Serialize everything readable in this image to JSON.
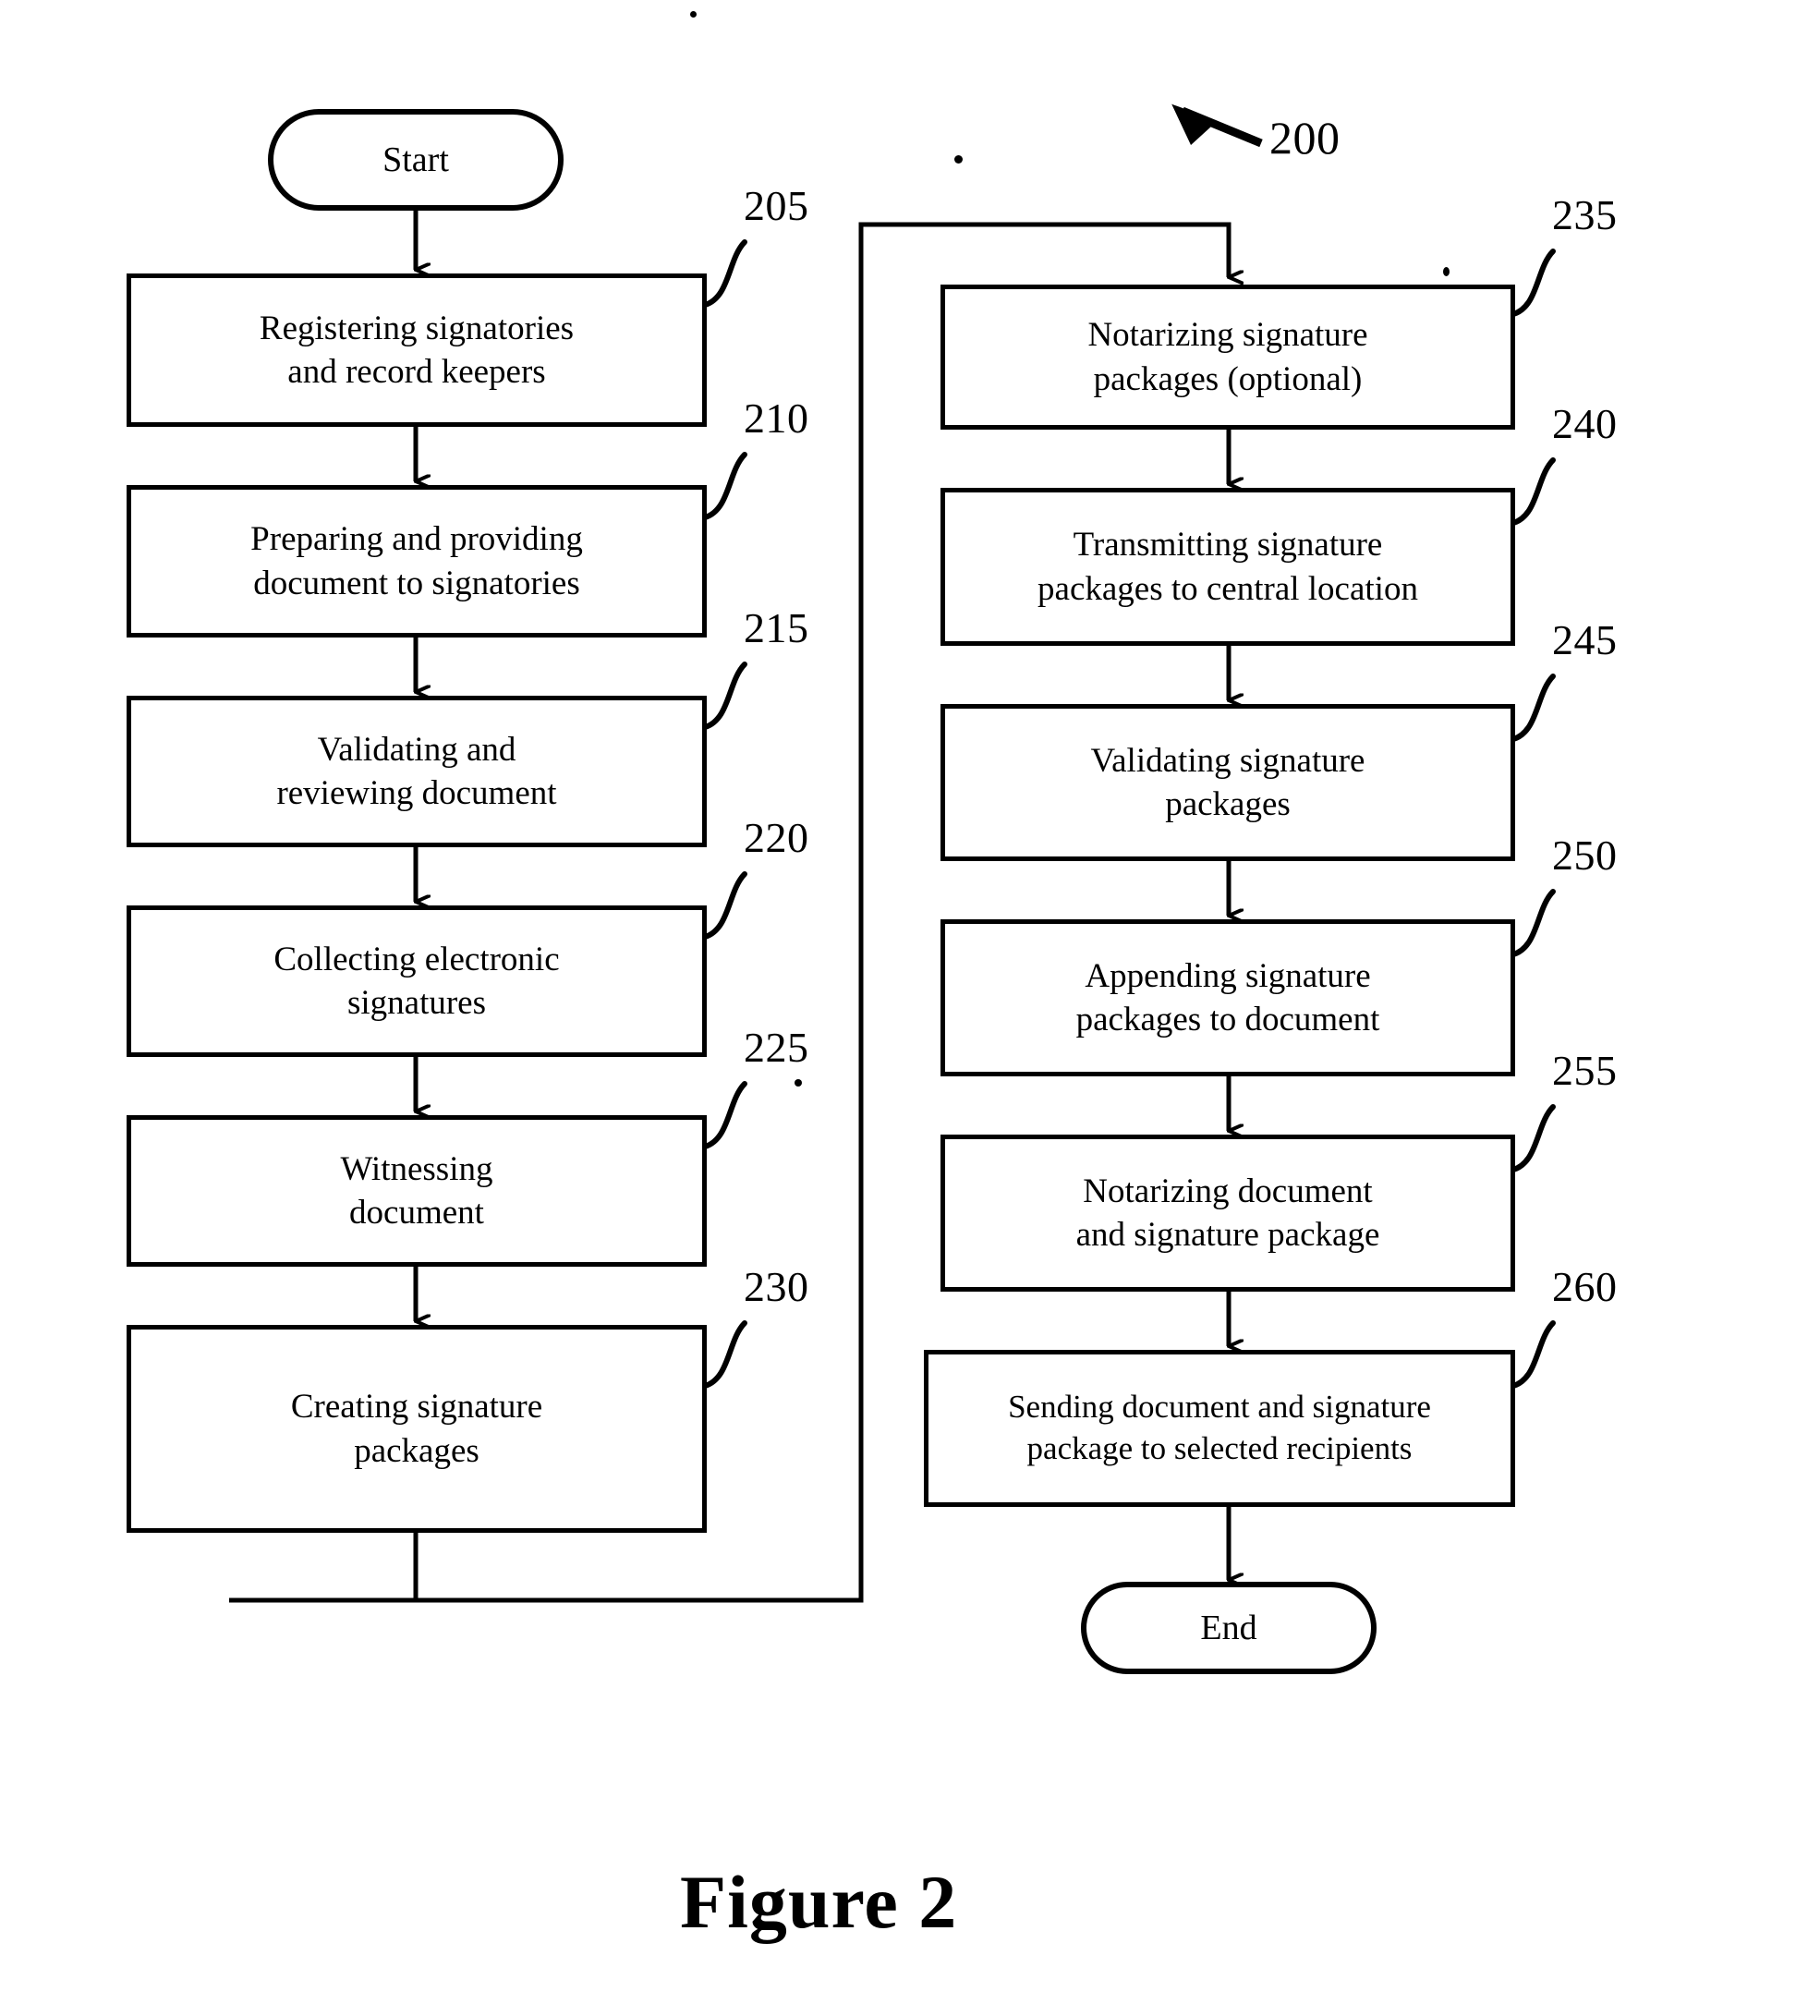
{
  "figure": {
    "caption": "Figure 2",
    "diagram_ref": "200"
  },
  "terminators": {
    "start": "Start",
    "end": "End"
  },
  "left_column": [
    {
      "ref": "205",
      "text": "Registering signatories\nand record keepers"
    },
    {
      "ref": "210",
      "text": "Preparing and providing\ndocument to signatories"
    },
    {
      "ref": "215",
      "text": "Validating and\nreviewing document"
    },
    {
      "ref": "220",
      "text": "Collecting electronic\nsignatures"
    },
    {
      "ref": "225",
      "text": "Witnessing\ndocument"
    },
    {
      "ref": "230",
      "text": "Creating signature\npackages"
    }
  ],
  "right_column": [
    {
      "ref": "235",
      "text": "Notarizing signature\npackages (optional)"
    },
    {
      "ref": "240",
      "text": "Transmitting signature\npackages to central location"
    },
    {
      "ref": "245",
      "text": "Validating signature\npackages"
    },
    {
      "ref": "250",
      "text": "Appending signature\npackages to document"
    },
    {
      "ref": "255",
      "text": "Notarizing document\nand signature package"
    },
    {
      "ref": "260",
      "text": "Sending document and signature\npackage to selected recipients"
    }
  ]
}
